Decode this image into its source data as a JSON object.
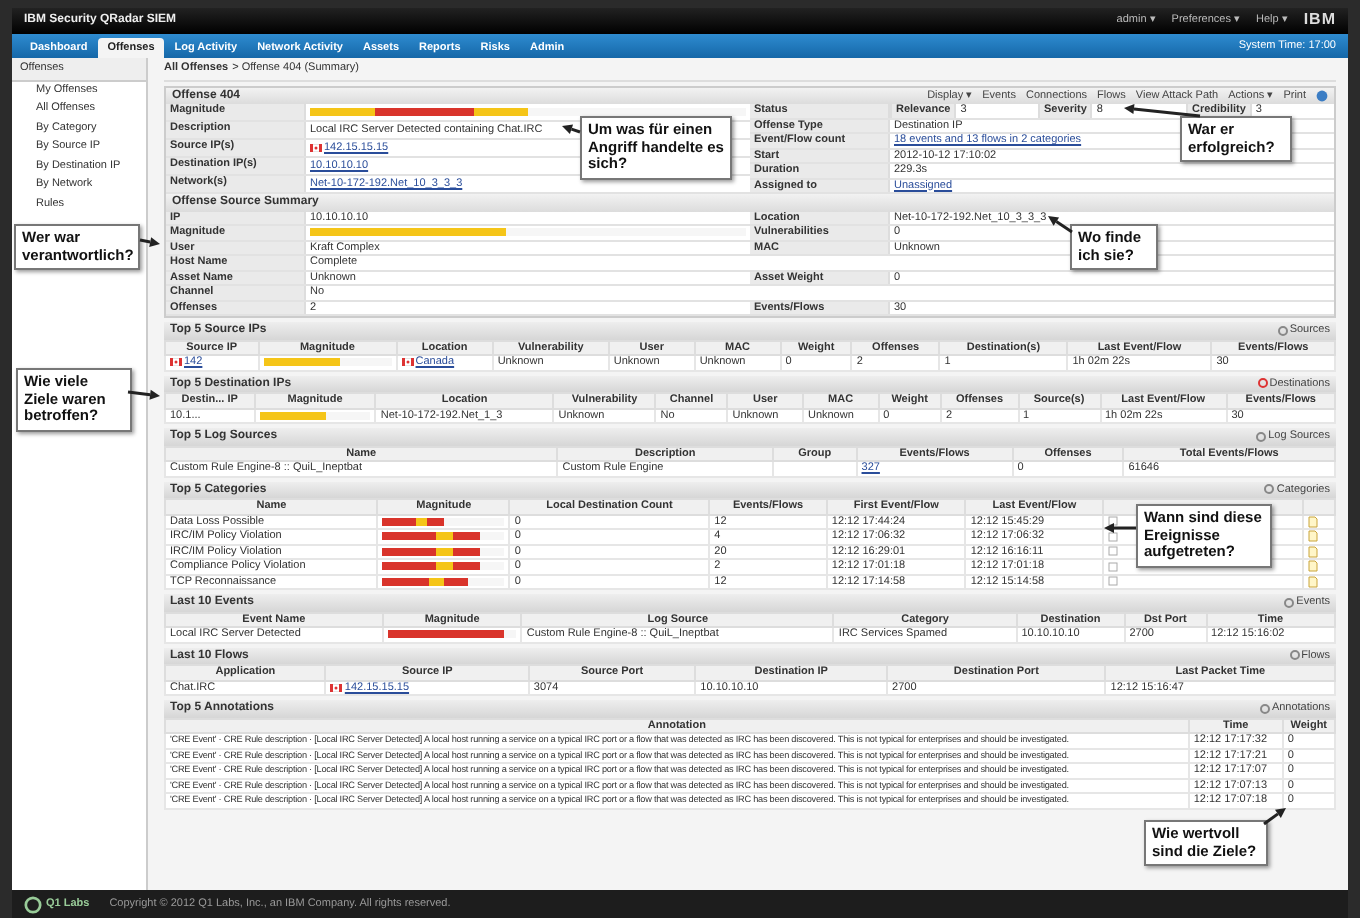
{
  "app": {
    "title": "IBM Security QRadar SIEM",
    "user_menu": [
      "admin ▾",
      "Preferences ▾",
      "Help ▾"
    ],
    "brand": "IBM",
    "system_time": "System Time: 17:00"
  },
  "tabs": [
    {
      "label": "Dashboard",
      "selected": false
    },
    {
      "label": "Offenses",
      "selected": true
    },
    {
      "label": "Log Activity",
      "selected": false
    },
    {
      "label": "Network Activity",
      "selected": false
    },
    {
      "label": "Assets",
      "selected": false
    },
    {
      "label": "Reports",
      "selected": false
    },
    {
      "label": "Risks",
      "selected": false
    },
    {
      "label": "Admin",
      "selected": false
    }
  ],
  "sidebar": {
    "title": "Offenses",
    "items": [
      "My Offenses",
      "All Offenses",
      "By Category",
      "By Source IP",
      "By Destination IP",
      "By Network",
      "Rules"
    ]
  },
  "breadcrumb": {
    "link": "All Offenses",
    "current": "> Offense 404 (Summary)"
  },
  "toolbar": [
    "Display ▾",
    "Events",
    "Connections",
    "Flows",
    "View Attack Path",
    "Actions ▾",
    "Print"
  ],
  "offense": {
    "title": "Offense 404",
    "left": [
      {
        "label": "Magnitude",
        "value": {
          "kind": "alertbar",
          "level": 0.5
        }
      },
      {
        "label": "Description",
        "value": "Local IRC Server Detected containing Chat.IRC"
      },
      {
        "label": "Source IP(s)",
        "value": {
          "kind": "flag",
          "text": "142.15.15.15"
        }
      },
      {
        "label": "Destination IP(s)",
        "value": {
          "kind": "link",
          "text": "10.10.10.10"
        }
      },
      {
        "label": "Network(s)",
        "value": {
          "kind": "link",
          "text": "Net-10-172-192.Net_10_3_3_3"
        }
      }
    ],
    "right": [
      {
        "label": "Status",
        "pairs": [
          {
            "label": "Relevance",
            "value": "3"
          },
          {
            "label": "Severity",
            "value": "8"
          },
          {
            "label": "Credibility",
            "value": "3"
          }
        ]
      },
      {
        "label": "Offense Type",
        "value": "Destination IP"
      },
      {
        "label": "Event/Flow count",
        "value": {
          "kind": "link",
          "text": "18 events and 13 flows in 2 categories"
        }
      },
      {
        "label": "Start",
        "value": "2012-10-12 17:10:02"
      },
      {
        "label": "Duration",
        "value": "229.3s"
      },
      {
        "label": "Assigned to",
        "value": {
          "kind": "link",
          "text": "Unassigned"
        }
      }
    ]
  },
  "source_summary": {
    "title": "Offense Source Summary",
    "rows": [
      {
        "left": {
          "label": "IP",
          "value": "10.10.10.10"
        },
        "right": {
          "label": "Location",
          "value": "Net-10-172-192.Net_10_3_3_3"
        }
      },
      {
        "left": {
          "label": "Magnitude",
          "value": {
            "kind": "bar",
            "level": 0.45
          }
        },
        "right": {
          "label": "Vulnerabilities",
          "value": "0"
        }
      },
      {
        "left": {
          "label": "User",
          "value": "Kraft Complex"
        },
        "right": {
          "label": "MAC",
          "value": "Unknown"
        }
      },
      {
        "left": {
          "label": "Host Name",
          "value": "Complete"
        }
      },
      {
        "left": {
          "label": "Asset Name",
          "value": "Unknown"
        },
        "right": {
          "label": "Asset Weight",
          "value": "0"
        }
      },
      {
        "left": {
          "label": "Channel",
          "value": "No"
        }
      },
      {
        "left": {
          "label": "Offenses",
          "value": "2"
        },
        "right": {
          "label": "Events/Flows",
          "value": "30"
        }
      }
    ]
  },
  "sections": [
    {
      "title": "Top 5 Source IPs",
      "kind": "table",
      "link": "Sources",
      "columns": [
        "Source IP",
        "Magnitude",
        "Location",
        "Vulnerability",
        "User",
        "MAC",
        "Weight",
        "Offenses",
        "Destination(s)",
        "Last Event/Flow",
        "Events/Flows"
      ],
      "rows": [
        [
          {
            "kind": "flag",
            "text": "142"
          },
          {
            "kind": "bar",
            "level": 0.6
          },
          {
            "kind": "flag",
            "text": "Canada"
          },
          "Unknown",
          "Unknown",
          "Unknown",
          "0",
          "2",
          "1",
          "1h 02m 22s",
          "30"
        ]
      ]
    },
    {
      "title": "Top 5 Destination IPs",
      "kind": "table",
      "link": "Destinations",
      "columns": [
        "Destin... IP",
        "Magnitude",
        "Location",
        "Vulnerability",
        "Channel",
        "User",
        "MAC",
        "Weight",
        "Offenses",
        "Source(s)",
        "Last Event/Flow",
        "Events/Flows"
      ],
      "rows": [
        [
          "10.1...",
          {
            "kind": "bar",
            "level": 0.6
          },
          "Net-10-172-192.Net_1_3",
          "Unknown",
          "No",
          "Unknown",
          "Unknown",
          "0",
          "2",
          "1",
          "1h 02m 22s",
          "30"
        ]
      ]
    },
    {
      "title": "Top 5 Log Sources",
      "kind": "table",
      "link": "Log Sources",
      "columns": [
        "Name",
        "Description",
        "Group",
        "Events/Flows",
        "Offenses",
        "Total Events/Flows"
      ],
      "rows": [
        [
          "Custom Rule Engine-8 :: QuiL_Ineptbat",
          "Custom Rule Engine",
          "",
          {
            "kind": "link",
            "text": "327"
          },
          "0",
          "61646"
        ]
      ]
    },
    {
      "title": "Top 5 Categories",
      "kind": "table",
      "link": "Categories",
      "columns": [
        "Name",
        "Magnitude",
        "Local Destination Count",
        "Events/Flows",
        "First Event/Flow",
        "Last Event/Flow"
      ],
      "rows": [
        [
          "Data Loss Possible",
          {
            "kind": "heatbar",
            "level": 0.5
          },
          "0",
          "12",
          "12:12 17:44:24",
          "12:12 15:45:29",
          {
            "kind": "noteicon"
          },
          {
            "kind": "docicon"
          }
        ],
        [
          "IRC/IM Policy Violation",
          {
            "kind": "heatbar",
            "level": 0.8
          },
          "0",
          "4",
          "12:12 17:06:32",
          "12:12 17:06:32",
          {
            "kind": "noteicon"
          },
          {
            "kind": "docicon"
          }
        ],
        [
          "IRC/IM Policy Violation",
          {
            "kind": "heatbar",
            "level": 0.8
          },
          "0",
          "20",
          "12:12 16:29:01",
          "12:12 16:16:11",
          {
            "kind": "noteicon"
          },
          {
            "kind": "docicon"
          }
        ],
        [
          "Compliance Policy Violation",
          {
            "kind": "heatbar",
            "level": 0.8
          },
          "0",
          "2",
          "12:12 17:01:18",
          "12:12 17:01:18",
          {
            "kind": "noteicon"
          },
          {
            "kind": "docicon"
          }
        ],
        [
          "TCP Reconnaissance",
          {
            "kind": "heatbar",
            "level": 0.7
          },
          "0",
          "12",
          "12:12 17:14:58",
          "12:12 15:14:58",
          {
            "kind": "noteicon"
          },
          {
            "kind": "docicon"
          }
        ]
      ]
    },
    {
      "title": "Last 10 Events",
      "kind": "table",
      "link": "Events",
      "columns": [
        "Event Name",
        "Magnitude",
        "Log Source",
        "Category",
        "Destination",
        "Dst Port",
        "Time"
      ],
      "rows": [
        [
          "Local IRC Server Detected",
          {
            "kind": "redbar",
            "level": 0.9
          },
          "Custom Rule Engine-8 :: QuiL_Ineptbat",
          "IRC Services Spamed",
          "10.10.10.10",
          "2700",
          "12:12 15:16:02"
        ]
      ]
    },
    {
      "title": "Last 10 Flows",
      "kind": "table",
      "link": "Flows",
      "columns": [
        "Application",
        "Source IP",
        "Source Port",
        "Destination IP",
        "Destination Port",
        "Last Packet Time"
      ],
      "rows": [
        [
          "Chat.IRC",
          {
            "kind": "flag",
            "text": "142.15.15.15"
          },
          "3074",
          "10.10.10.10",
          "2700",
          "12:12 15:16:47"
        ]
      ]
    },
    {
      "title": "Top 5 Annotations",
      "kind": "notes",
      "link": "Annotations",
      "columns": [
        "Annotation",
        "Time",
        "Weight"
      ],
      "rows": [
        [
          "'CRE Event' · CRE Rule description · [Local IRC Server Detected] A local host running a service on a typical IRC port or a flow that was detected as IRC has been discovered. This is not typical for enterprises and should be investigated.",
          "12:12 17:17:32",
          "0"
        ],
        [
          "'CRE Event' · CRE Rule description · [Local IRC Server Detected] A local host running a service on a typical IRC port or a flow that was detected as IRC has been discovered. This is not typical for enterprises and should be investigated.",
          "12:12 17:17:21",
          "0"
        ],
        [
          "'CRE Event' · CRE Rule description · [Local IRC Server Detected] A local host running a service on a typical IRC port or a flow that was detected as IRC has been discovered. This is not typical for enterprises and should be investigated.",
          "12:12 17:17:07",
          "0"
        ],
        [
          "'CRE Event' · CRE Rule description · [Local IRC Server Detected] A local host running a service on a typical IRC port or a flow that was detected as IRC has been discovered. This is not typical for enterprises and should be investigated.",
          "12:12 17:07:13",
          "0"
        ],
        [
          "'CRE Event' · CRE Rule description · [Local IRC Server Detected] A local host running a service on a typical IRC port or a flow that was detected as IRC has been discovered. This is not typical for enterprises and should be investigated.",
          "12:12 17:07:18",
          "0"
        ]
      ]
    }
  ],
  "footer": {
    "logo": "Q1 Labs",
    "copyright": "Copyright © 2012 Q1 Labs, Inc., an IBM Company. All rights reserved."
  },
  "callouts": [
    "Um was für einen Angriff handelte es sich?",
    "War er erfolgreich?",
    "Wer war verantwortlich?",
    "Wo finde ich sie?",
    "Wie viele Ziele waren betroffen?",
    "Wann sind diese Ereignisse aufgetreten?",
    "Wie wertvoll sind die Ziele?"
  ]
}
